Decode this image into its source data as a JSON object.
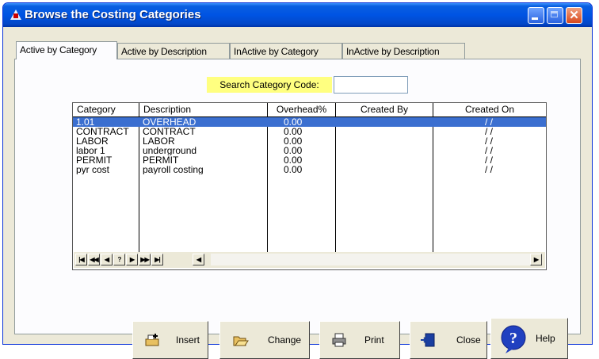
{
  "window": {
    "title": "Browse the Costing Categories"
  },
  "tabs": [
    {
      "label": "Active by Category"
    },
    {
      "label": "Active by Description"
    },
    {
      "label": "InActive by Category"
    },
    {
      "label": "InActive by Description"
    }
  ],
  "search": {
    "label": "Search Category Code:",
    "value": ""
  },
  "grid": {
    "columns": [
      "Category",
      "Description",
      "Overhead%",
      "Created By",
      "Created On"
    ],
    "rows": [
      {
        "category": "1.01",
        "description": "OVERHEAD",
        "overhead": "0.00",
        "created_by": "",
        "created_on": "/ /"
      },
      {
        "category": "CONTRACT",
        "description": "CONTRACT",
        "overhead": "0.00",
        "created_by": "",
        "created_on": "/ /"
      },
      {
        "category": "LABOR",
        "description": "LABOR",
        "overhead": "0.00",
        "created_by": "",
        "created_on": "/ /"
      },
      {
        "category": "labor 1",
        "description": "underground",
        "overhead": "0.00",
        "created_by": "",
        "created_on": "/ /"
      },
      {
        "category": "PERMIT",
        "description": "PERMIT",
        "overhead": "0.00",
        "created_by": "",
        "created_on": "/ /"
      },
      {
        "category": "pyr cost",
        "description": "payroll costing",
        "overhead": "0.00",
        "created_by": "",
        "created_on": "/ /"
      }
    ],
    "nav": [
      "|◀",
      "◀◀",
      "◀",
      "?",
      "▶",
      "▶▶",
      "▶|"
    ]
  },
  "buttons": {
    "insert": "Insert",
    "change": "Change",
    "print": "Print",
    "close": "Close",
    "help": "Help"
  },
  "colors": {
    "titlebar": "#0054e3",
    "selection": "#3b6fd0",
    "search_label_bg": "#ffff80",
    "face": "#ece9d8"
  }
}
